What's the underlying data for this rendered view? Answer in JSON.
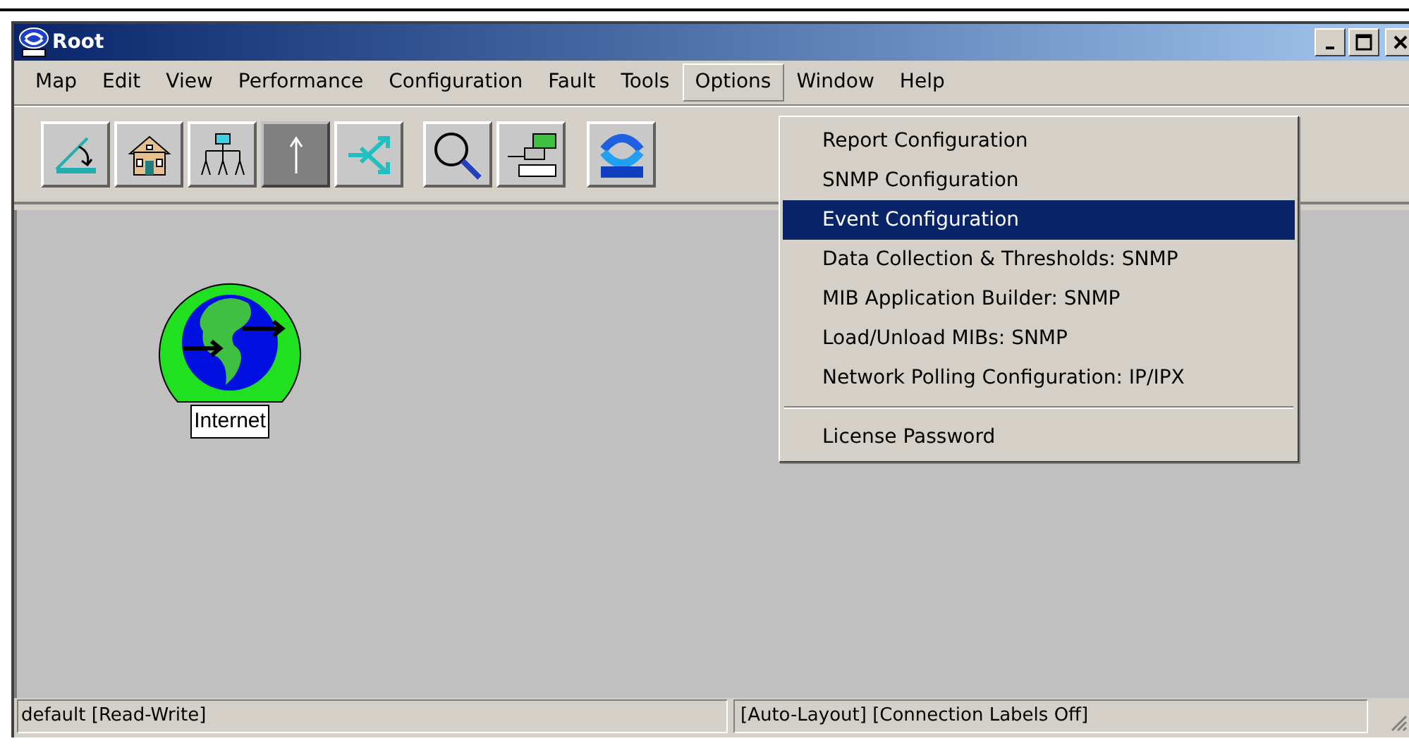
{
  "window": {
    "title": "Root"
  },
  "menu_bar": [
    {
      "label": "Map",
      "selected": false
    },
    {
      "label": "Edit",
      "selected": false
    },
    {
      "label": "View",
      "selected": false
    },
    {
      "label": "Performance",
      "selected": false
    },
    {
      "label": "Configuration",
      "selected": false
    },
    {
      "label": "Fault",
      "selected": false
    },
    {
      "label": "Tools",
      "selected": false
    },
    {
      "label": "Options",
      "selected": true
    },
    {
      "label": "Window",
      "selected": false
    },
    {
      "label": "Help",
      "selected": false
    }
  ],
  "toolbar": [
    {
      "pressed": false
    },
    {
      "pressed": false
    },
    {
      "pressed": false
    },
    {
      "pressed": true
    },
    {
      "pressed": false
    },
    {
      "pressed": false
    },
    {
      "pressed": false
    },
    {
      "pressed": false
    }
  ],
  "options_menu": [
    {
      "kind": "item",
      "label": "Report Configuration",
      "selected": false
    },
    {
      "kind": "item",
      "label": "SNMP Configuration",
      "selected": false
    },
    {
      "kind": "item",
      "label": "Event Configuration",
      "selected": true
    },
    {
      "kind": "item",
      "label": "Data Collection & Thresholds: SNMP",
      "selected": false
    },
    {
      "kind": "item",
      "label": "MIB Application Builder: SNMP",
      "selected": false
    },
    {
      "kind": "item",
      "label": "Load/Unload MIBs: SNMP",
      "selected": false
    },
    {
      "kind": "item",
      "label": "Network Polling Configuration: IP/IPX",
      "selected": false
    },
    {
      "kind": "separator"
    },
    {
      "kind": "item",
      "label": "License Password",
      "selected": false
    }
  ],
  "map": {
    "nodes": [
      {
        "label": "Internet"
      }
    ]
  },
  "status_bar": [
    "default [Read-Write]",
    "[Auto-Layout] [Connection Labels Off]"
  ]
}
